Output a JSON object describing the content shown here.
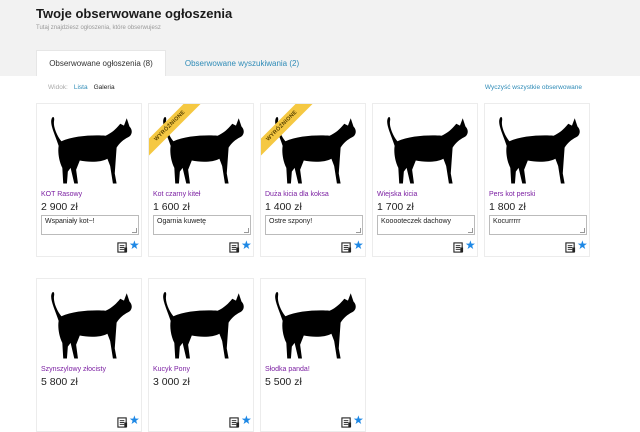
{
  "header": {
    "title": "Twoje obserwowane ogłoszenia",
    "subtitle": "Tutaj znajdziesz ogłoszenia, które obserwujesz"
  },
  "tabs": [
    {
      "label": "Obserwowane ogłoszenia (8)",
      "active": true
    },
    {
      "label": "Obserwowane wyszukiwania (2)",
      "active": false
    }
  ],
  "view": {
    "label": "Widok:",
    "options": [
      "Lista",
      "Galeria"
    ],
    "selected": "Lista"
  },
  "clear_all": "Wyczyść wszystkie obserwowane",
  "colors": {
    "accent_blue": "#2e8bb7",
    "listing_name": "#7b1fa2",
    "ribbon": "#f5c842",
    "star": "#1e88e5"
  },
  "listings": [
    {
      "name": "KOT Rasowy",
      "price": "2 900 zł",
      "note": "Wspaniały kot~!",
      "featured": false,
      "ribbon": ""
    },
    {
      "name": "Kot czarny kiteł",
      "price": "1 600 zł",
      "note": "Ogarnia kuwetę",
      "featured": true,
      "ribbon": "WYRÓŻNIONE"
    },
    {
      "name": "Duża kicia dla koksa",
      "price": "1 400 zł",
      "note": "Ostre szpony!",
      "featured": true,
      "ribbon": "WYRÓŻNIONE"
    },
    {
      "name": "Wiejska kicia",
      "price": "1 700 zł",
      "note": "Kooooteczek dachowy",
      "featured": false,
      "ribbon": ""
    },
    {
      "name": "Pers kot perski",
      "price": "1 800 zł",
      "note": "Kocurrrrr",
      "featured": false,
      "ribbon": ""
    },
    {
      "name": "Szynszylowy złocisty",
      "price": "5 800 zł",
      "note": "",
      "featured": false,
      "ribbon": ""
    },
    {
      "name": "Kucyk Pony",
      "price": "3 000 zł",
      "note": "",
      "featured": false,
      "ribbon": ""
    },
    {
      "name": "Słodka panda!",
      "price": "5 500 zł",
      "note": "",
      "featured": false,
      "ribbon": ""
    }
  ],
  "icons": {
    "image": "black-cat-silhouette",
    "note": "notepad-icon",
    "favorite": "star-icon"
  }
}
